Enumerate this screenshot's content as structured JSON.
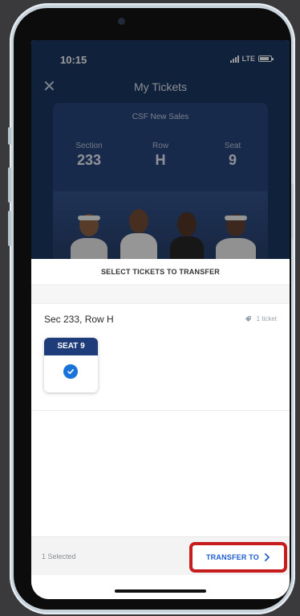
{
  "status_bar": {
    "time": "10:15",
    "network": "LTE",
    "icons": [
      "signal-icon",
      "battery-icon"
    ]
  },
  "nav": {
    "close_icon": "close-icon",
    "title": "My Tickets"
  },
  "ticket_card": {
    "event_name": "CSF New Sales",
    "section_label": "Section",
    "section_value": "233",
    "row_label": "Row",
    "row_value": "H",
    "seat_label": "Seat",
    "seat_value": "9"
  },
  "sheet": {
    "title": "SELECT TICKETS TO TRANSFER",
    "group_label": "Sec 233, Row H",
    "ticket_count": "1 ticket",
    "seat_tile_label": "SEAT 9",
    "seat_selected": true
  },
  "footer": {
    "selected_text": "1 Selected",
    "transfer_label": "TRANSFER TO"
  },
  "colors": {
    "brand_navy": "#1f3c7a",
    "accent_blue": "#1a73d9",
    "highlight_red": "#c61c1c"
  }
}
